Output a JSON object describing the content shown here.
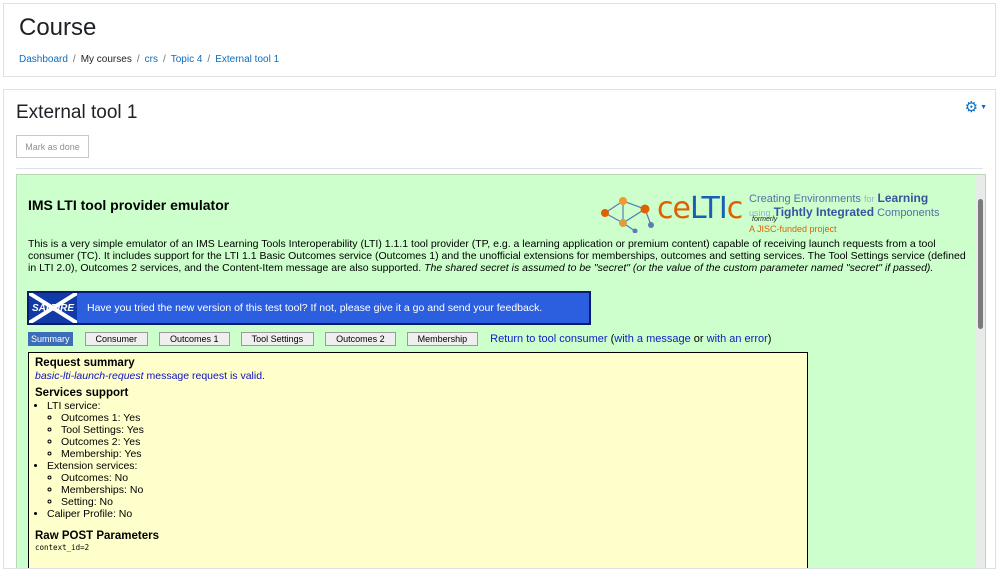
{
  "header": {
    "title": "Course",
    "breadcrumb": [
      {
        "label": "Dashboard",
        "link": true
      },
      {
        "label": "My courses",
        "link": false
      },
      {
        "label": "crs",
        "link": true
      },
      {
        "label": "Topic 4",
        "link": true
      },
      {
        "label": "External tool 1",
        "link": true
      }
    ],
    "separator": "/"
  },
  "activity": {
    "title": "External tool 1",
    "mark_done_label": "Mark as done",
    "settings_icon": "gear-icon"
  },
  "tool": {
    "title": "IMS LTI tool provider emulator",
    "logo": {
      "wordmark_ce": "ce",
      "wordmark_lti": "LTI",
      "wordmark_c": "c",
      "tag_line1_a": "Creating Environments",
      "tag_line1_b": "for",
      "tag_line1_c": "Learning",
      "tag_line2_a": "using",
      "tag_line2_b": "Tightly Integrated",
      "tag_line2_c": "Components",
      "formerly": "formerly",
      "jisc": "A JISC-funded project"
    },
    "description": "This is a very simple emulator of an IMS Learning Tools Interoperability (LTI) 1.1.1 tool provider (TP, e.g. a learning application or premium content) capable of receiving launch requests from a tool consumer (TC). It includes support for the LTI 1.1 Basic Outcomes service (Outcomes 1) and the unofficial extensions for memberships, outcomes and setting services. The Tool Settings service (defined in LTI 2.0), Outcomes 2 services, and the Content-Item message are also supported.",
    "description_italic": "The shared secret is assumed to be \"secret\" (or the value of the custom parameter named \"secret\" if passed).",
    "banner": {
      "badge": "SALTIRE",
      "text": "Have you tried the new version of this test tool? If not, please give it a go and send your feedback."
    },
    "tabs": [
      "Summary",
      "Consumer",
      "Outcomes 1",
      "Tool Settings",
      "Outcomes 2",
      "Membership"
    ],
    "selected_tab": "Summary",
    "return": {
      "main": "Return to tool consumer",
      "open": "(",
      "with_message": "with a message",
      "or": "or",
      "with_error": "with an error",
      "close": ")"
    },
    "summary": {
      "heading": "Request summary",
      "valid_message": "basic-lti-launch-request",
      "valid_suffix": "message request is valid.",
      "services_heading": "Services support",
      "lti_service_label": "LTI service:",
      "lti_services": [
        "Outcomes 1: Yes",
        "Tool Settings: Yes",
        "Outcomes 2: Yes",
        "Membership: Yes"
      ],
      "extension_label": "Extension services:",
      "extension_services": [
        "Outcomes: No",
        "Memberships: No",
        "Setting: No"
      ],
      "caliper": "Caliper Profile: No",
      "raw_heading": "Raw POST Parameters",
      "raw_first": "context_id=2"
    }
  },
  "colors": {
    "link": "#0f6cbf",
    "tool_bg": "#ccffcc",
    "summary_bg": "#ffffcc",
    "banner_bg": "#2b5fe0"
  }
}
